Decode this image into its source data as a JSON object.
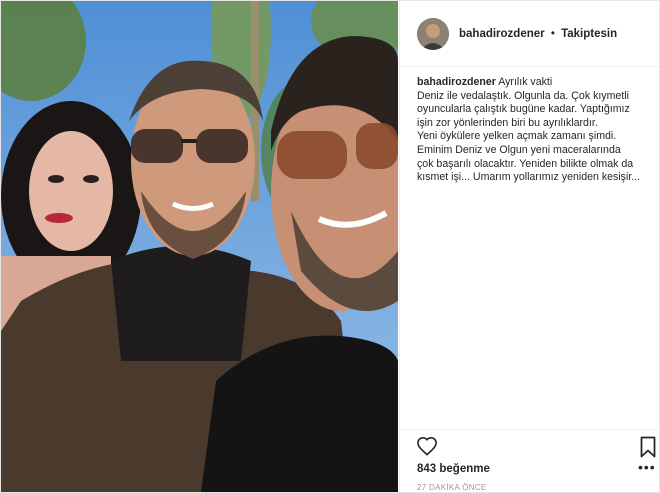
{
  "header": {
    "username": "bahadirozdener",
    "separator": "•",
    "follow_status": "Takiptesin"
  },
  "caption": {
    "username": "bahadirozdener",
    "title": "Ayrılık vakti",
    "lines": [
      "Deniz ile vedalaştık. Olgunla da. Çok kıymetli",
      "oyuncularla çalıştık bugüne kadar. Yaptığımız",
      "işin zor yönlerinden biri bu ayrılıklardır.",
      "Yeni öykülere yelken açmak zamanı şimdi.",
      "Eminim Deniz ve Olgun yeni maceralarında",
      "çok başarılı olacaktır. Yeniden bilikte olmak da",
      "kısmet işi... Umarım yollarımız yeniden kesişir..."
    ]
  },
  "footer": {
    "likes": "843 beğenme",
    "timestamp": "27 DAKİKA ÖNCE",
    "more": "•••"
  },
  "icons": {
    "like": "heart-icon",
    "save": "bookmark-icon",
    "more": "more-options-icon"
  },
  "colors": {
    "text": "#262626",
    "muted": "#999999",
    "border": "#efefef"
  }
}
